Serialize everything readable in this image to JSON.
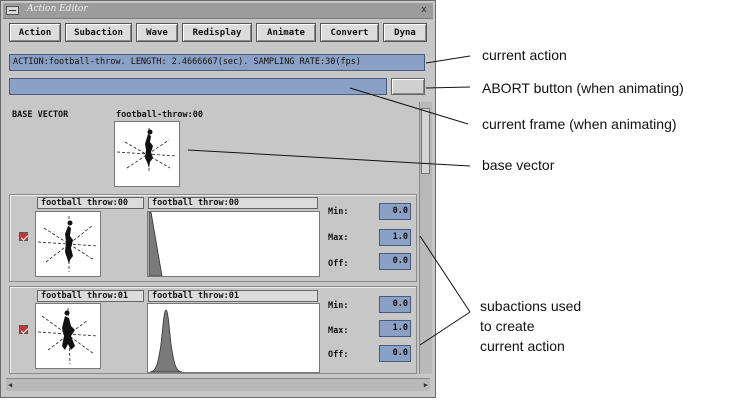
{
  "window": {
    "title": "Action Editor",
    "close_glyph": "x"
  },
  "toolbar": {
    "buttons": [
      "Action",
      "Subaction",
      "Wave",
      "Redisplay",
      "Animate",
      "Convert",
      "Dyna"
    ]
  },
  "action_field": "ACTION:football-throw. LENGTH: 2.4666667(sec). SAMPLING RATE:30(fps)",
  "base_vector": {
    "label": "BASE VECTOR",
    "name": "football-throw:00"
  },
  "subactions": [
    {
      "thumb_label": "football throw:00",
      "graph_label": "football throw:00",
      "checked": true,
      "min_label": "Min:",
      "min_value": "0.0",
      "max_label": "Max:",
      "max_value": "1.0",
      "off_label": "Off:",
      "off_value": "0.0"
    },
    {
      "thumb_label": "football throw:01",
      "graph_label": "football throw:01",
      "checked": true,
      "min_label": "Min:",
      "min_value": "0.0",
      "max_label": "Max:",
      "max_value": "1.0",
      "off_label": "Off:",
      "off_value": "0.0"
    }
  ],
  "annotations": {
    "current_action": "current action",
    "abort": "ABORT button (when animating)",
    "current_frame": "current frame (when animating)",
    "base_vector": "base vector",
    "subactions_line1": "subactions used",
    "subactions_line2": "to create",
    "subactions_line3": "current action"
  },
  "colors": {
    "window_bg": "#c7c7c7",
    "field_blue": "#8aa0c4",
    "checkbox_red": "#c0383a"
  }
}
